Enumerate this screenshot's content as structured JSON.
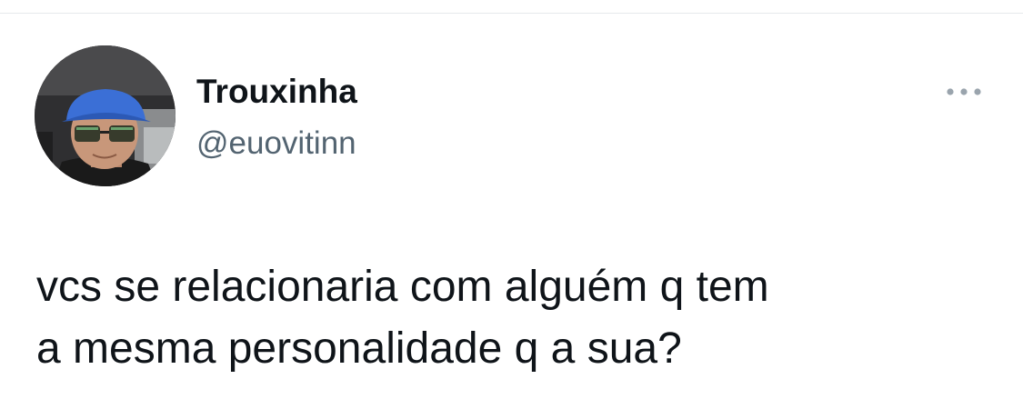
{
  "colors": {
    "background": "#ffffff",
    "text_primary": "#0f1419",
    "text_secondary": "#536471",
    "divider": "#e6e9ec"
  },
  "tweet": {
    "author": {
      "display_name": "Trouxinha",
      "handle": "@euovitinn",
      "avatar_icon": "profile-photo"
    },
    "more_icon": "more-horizontal-icon",
    "text_lines": [
      "vcs se relacionaria com alguém q tem",
      "a mesma personalidade q a sua?"
    ]
  }
}
